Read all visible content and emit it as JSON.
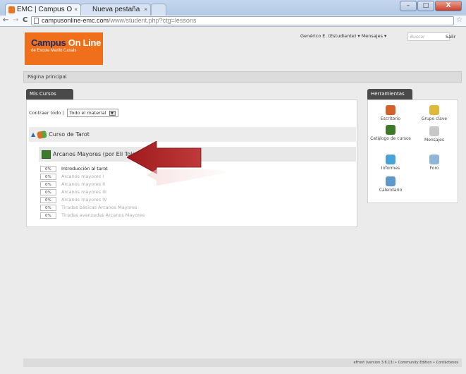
{
  "browser": {
    "tabs": [
      {
        "label": "EMC | Campus O"
      },
      {
        "label": "Nueva pestaña"
      }
    ],
    "url_host": "campusonline-emc.com",
    "url_path": "/www/student.php?ctg=lessons",
    "window_controls": {
      "minimize": "–",
      "maximize": "□",
      "close": "X"
    },
    "nav": {
      "back": "←",
      "forward": "→",
      "reload": "C",
      "bookmark": "☆"
    },
    "tab_close": "×"
  },
  "logo": {
    "title_a": "Campus",
    "title_b": " On Line",
    "subtitle": "de  Escola Marilò Casals"
  },
  "header": {
    "user_menu": "Genérico E. (Estudiante) ▾   Mensajes ▾",
    "search_placeholder": "Buscar",
    "logout": "Salir"
  },
  "breadcrumb": "Página principal",
  "my_courses": {
    "tab_label": "Mis Cursos",
    "collapse_label": "Contraer todo |",
    "filter_value": "Todo el material",
    "course": "Curso de Tarot",
    "lesson": "Arcanos Mayores (por Eli Tolo)",
    "units": [
      {
        "progress": "0%",
        "label": "Introducción al tarot",
        "active": true
      },
      {
        "progress": "0%",
        "label": "Arcanos mayores I",
        "active": false
      },
      {
        "progress": "0%",
        "label": "Arcanos mayores II",
        "active": false
      },
      {
        "progress": "0%",
        "label": "Arcanos mayores III",
        "active": false
      },
      {
        "progress": "0%",
        "label": "Arcanos mayores IV",
        "active": false
      },
      {
        "progress": "0%",
        "label": "Tiradas básicas Arcanos Mayores",
        "active": false
      },
      {
        "progress": "0%",
        "label": "Tiradas avanzadas Arcanos Mayores",
        "active": false
      }
    ]
  },
  "tools": {
    "tab_label": "Herramientas",
    "items": [
      {
        "label": "Escritorio",
        "icon": "user-icon",
        "color": "#d2622a"
      },
      {
        "label": "Grupo clave",
        "icon": "key-icon",
        "color": "#e0b83a"
      },
      {
        "label": "Catálogo de cursos",
        "icon": "catalog-icon",
        "color": "#3d7b2b"
      },
      {
        "label": "Mensajes",
        "icon": "envelope-icon",
        "color": "#c8c8c8"
      },
      {
        "label": "Informes",
        "icon": "chart-icon",
        "color": "#4aa3d8"
      },
      {
        "label": "Foro",
        "icon": "forum-icon",
        "color": "#8fb5d9"
      },
      {
        "label": "Calendario",
        "icon": "calendar-icon",
        "color": "#5e97c9"
      }
    ]
  },
  "footer": "eFront (version 3.6.13) • Community Edition • Contáctenos"
}
